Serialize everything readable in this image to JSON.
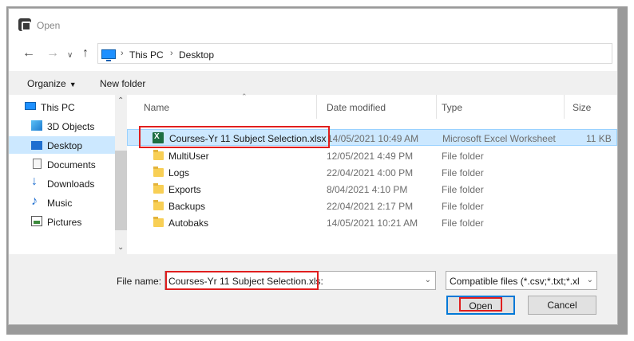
{
  "window": {
    "title": "Open"
  },
  "nav": {
    "back_icon": "arrow-left-icon",
    "forward_icon": "arrow-right-icon",
    "recent_icon": "chevron-down-icon",
    "up_icon": "arrow-up-icon",
    "breadcrumb": [
      "This PC",
      "Desktop"
    ]
  },
  "toolbar": {
    "organize_label": "Organize",
    "new_folder_label": "New folder"
  },
  "sidebar": {
    "items": [
      {
        "label": "This PC",
        "icon": "pc-icon",
        "selected": false
      },
      {
        "label": "3D Objects",
        "icon": "cube-icon",
        "selected": false
      },
      {
        "label": "Desktop",
        "icon": "desktop-icon",
        "selected": true
      },
      {
        "label": "Documents",
        "icon": "document-icon",
        "selected": false
      },
      {
        "label": "Downloads",
        "icon": "download-icon",
        "selected": false
      },
      {
        "label": "Music",
        "icon": "music-icon",
        "selected": false
      },
      {
        "label": "Pictures",
        "icon": "pictures-icon",
        "selected": false
      }
    ]
  },
  "list": {
    "columns": {
      "name": "Name",
      "date": "Date modified",
      "type": "Type",
      "size": "Size"
    },
    "rows": [
      {
        "name": "Courses-Yr 11 Subject Selection.xlsx",
        "date": "14/05/2021 10:49 AM",
        "type": "Microsoft Excel Worksheet",
        "size": "11 KB",
        "icon": "excel-file-icon",
        "selected": true
      },
      {
        "name": "MultiUser",
        "date": "12/05/2021 4:49 PM",
        "type": "File folder",
        "size": "",
        "icon": "folder-icon",
        "selected": false
      },
      {
        "name": "Logs",
        "date": "22/04/2021 4:00 PM",
        "type": "File folder",
        "size": "",
        "icon": "folder-icon",
        "selected": false
      },
      {
        "name": "Exports",
        "date": "8/04/2021 4:10 PM",
        "type": "File folder",
        "size": "",
        "icon": "folder-icon",
        "selected": false
      },
      {
        "name": "Backups",
        "date": "22/04/2021 2:17 PM",
        "type": "File folder",
        "size": "",
        "icon": "folder-icon",
        "selected": false
      },
      {
        "name": "Autobaks",
        "date": "14/05/2021 10:21 AM",
        "type": "File folder",
        "size": "",
        "icon": "folder-icon",
        "selected": false
      }
    ]
  },
  "footer": {
    "file_name_label": "File name:",
    "file_name_value": "Courses-Yr 11 Subject Selection.xls:",
    "filter_value": "Compatible files (*.csv;*.txt;*.xl",
    "open_label": "Open",
    "cancel_label": "Cancel"
  },
  "colors": {
    "highlight": "#e01e1e",
    "selection": "#cce8ff",
    "accent": "#0078d7"
  }
}
